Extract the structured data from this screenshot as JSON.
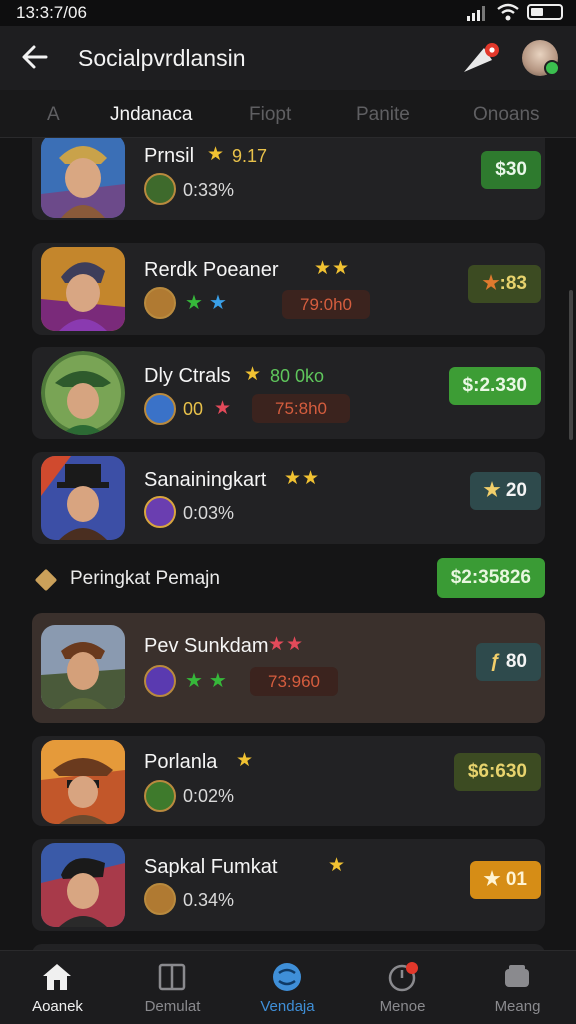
{
  "status": {
    "time": "13:3:7/06"
  },
  "header": {
    "title": "Socialpvrdlansin"
  },
  "tabs": [
    {
      "label": "A"
    },
    {
      "label": "Jndanaca"
    },
    {
      "label": "Fiopt"
    },
    {
      "label": "Panite"
    },
    {
      "label": "Onoans"
    }
  ],
  "rows": [
    {
      "name": "Prnsil",
      "rating": "9.17",
      "pct": "0:33%",
      "price": "$30",
      "price_color": "#2e7a2e"
    },
    {
      "name": "Rerdk Poeaner",
      "timer": "79:0h0",
      "price": ":83"
    },
    {
      "name": "Dly Ctrals",
      "rating": "80 0ko",
      "sub": "00",
      "timer": "75:8h0",
      "price": "$:2.330"
    },
    {
      "name": "Sanainingkart",
      "pct": "0:03%",
      "price": "20"
    },
    {
      "name": "Pev Sunkdam",
      "timer": "73:960",
      "price": "80"
    },
    {
      "name": "Porlanla",
      "pct": "0:02%",
      "price": "$6:630"
    },
    {
      "name": "Sapkal Fumkat",
      "pct": "0.34%",
      "price": "01"
    }
  ],
  "section": {
    "label": "Peringkat Pemajn",
    "price": "$2:35826"
  },
  "nav": [
    {
      "label": "Aoanek"
    },
    {
      "label": "Demulat"
    },
    {
      "label": "Vendaja"
    },
    {
      "label": "Menoe"
    },
    {
      "label": "Meang"
    }
  ],
  "colors": {
    "accent": "#3f8fd8",
    "green": "#3a9b35",
    "gold": "#e8c14a",
    "timer": "#d55d3e"
  }
}
